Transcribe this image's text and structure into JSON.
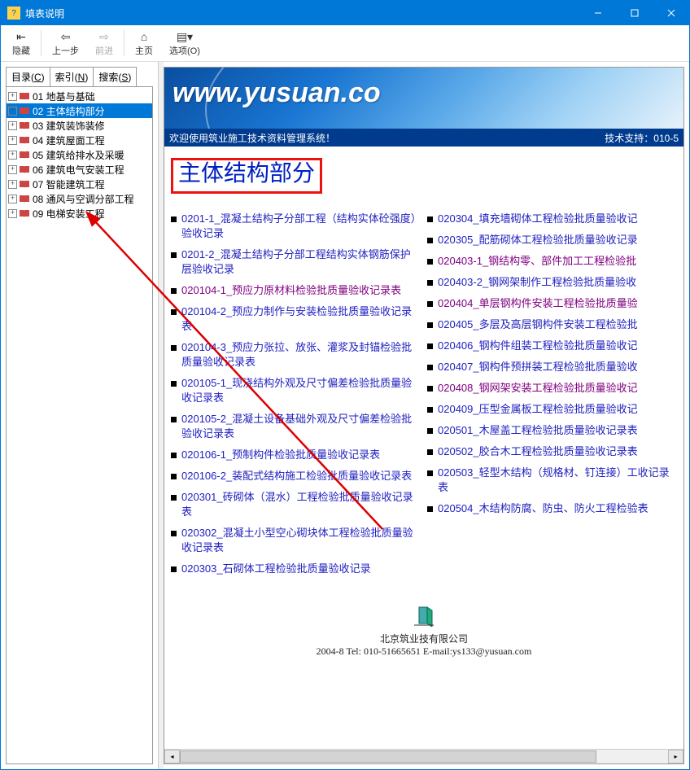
{
  "window": {
    "title": "填表说明"
  },
  "toolbar": {
    "hide": "隐藏",
    "back": "上一步",
    "forward": "前进",
    "home": "主页",
    "options": "选项(O)"
  },
  "tabs": {
    "contents": "目录(C)",
    "index": "索引(N)",
    "search": "搜索(S)"
  },
  "tree": [
    {
      "label": "01 地基与基础",
      "selected": false
    },
    {
      "label": "02 主体结构部分",
      "selected": true
    },
    {
      "label": "03 建筑装饰装修",
      "selected": false
    },
    {
      "label": "04 建筑屋面工程",
      "selected": false
    },
    {
      "label": "05 建筑给排水及采暖",
      "selected": false
    },
    {
      "label": "06 建筑电气安装工程",
      "selected": false
    },
    {
      "label": "07 智能建筑工程",
      "selected": false
    },
    {
      "label": "08 通风与空调分部工程",
      "selected": false
    },
    {
      "label": "09 电梯安装工程",
      "selected": false
    }
  ],
  "banner": {
    "url": "www.yusuan.co"
  },
  "welcome": {
    "left": "欢迎使用筑业施工技术资料管理系统！",
    "right": "技术支持：010-5"
  },
  "page": {
    "title": "主体结构部分"
  },
  "links_left": [
    {
      "t": "0201-1_混凝土结构子分部工程（结构实体砼强度）验收记录",
      "v": false
    },
    {
      "t": "0201-2_混凝土结构子分部工程结构实体钢筋保护层验收记录",
      "v": false
    },
    {
      "t": "020104-1_预应力原材料检验批质量验收记录表",
      "v": true
    },
    {
      "t": "020104-2_预应力制作与安装检验批质量验收记录表",
      "v": false
    },
    {
      "t": "020104-3_预应力张拉、放张、灌浆及封锚检验批质量验收记录表",
      "v": false
    },
    {
      "t": "020105-1_现浇结构外观及尺寸偏差检验批质量验收记录表",
      "v": false
    },
    {
      "t": "020105-2_混凝土设备基础外观及尺寸偏差检验批验收记录表",
      "v": false
    },
    {
      "t": "020106-1_预制构件检验批质量验收记录表",
      "v": false
    },
    {
      "t": "020106-2_装配式结构施工检验批质量验收记录表",
      "v": false
    },
    {
      "t": "020301_砖砌体（混水）工程检验批质量验收记录表",
      "v": false
    },
    {
      "t": "020302_混凝土小型空心砌块体工程检验批质量验收记录表",
      "v": false
    },
    {
      "t": "020303_石砌体工程检验批质量验收记录",
      "v": false
    }
  ],
  "links_right": [
    {
      "t": "020304_填充墙砌体工程检验批质量验收记",
      "v": false
    },
    {
      "t": "020305_配筋砌体工程检验批质量验收记录",
      "v": false
    },
    {
      "t": "020403-1_钢结构零、部件加工工程检验批",
      "v": true
    },
    {
      "t": "020403-2_钢网架制作工程检验批质量验收",
      "v": false
    },
    {
      "t": "020404_单层钢构件安装工程检验批质量验",
      "v": true
    },
    {
      "t": "020405_多层及高层钢构件安装工程检验批",
      "v": false
    },
    {
      "t": "020406_钢构件组装工程检验批质量验收记",
      "v": false
    },
    {
      "t": "020407_钢构件预拼装工程检验批质量验收",
      "v": false
    },
    {
      "t": "020408_钢网架安装工程检验批质量验收记",
      "v": true
    },
    {
      "t": "020409_压型金属板工程检验批质量验收记",
      "v": false
    },
    {
      "t": "020501_木屋盖工程检验批质量验收记录表",
      "v": false
    },
    {
      "t": "020502_胶合木工程检验批质量验收记录表",
      "v": false
    },
    {
      "t": "020503_轻型木结构（规格材、钉连接）工收记录表",
      "v": false
    },
    {
      "t": "020504_木结构防腐、防虫、防火工程检验表",
      "v": false
    }
  ],
  "footer": {
    "company": "北京筑业技有限公司",
    "contact": "2004-8 Tel: 010-51665651   E-mail:ys133@yusuan.com"
  }
}
